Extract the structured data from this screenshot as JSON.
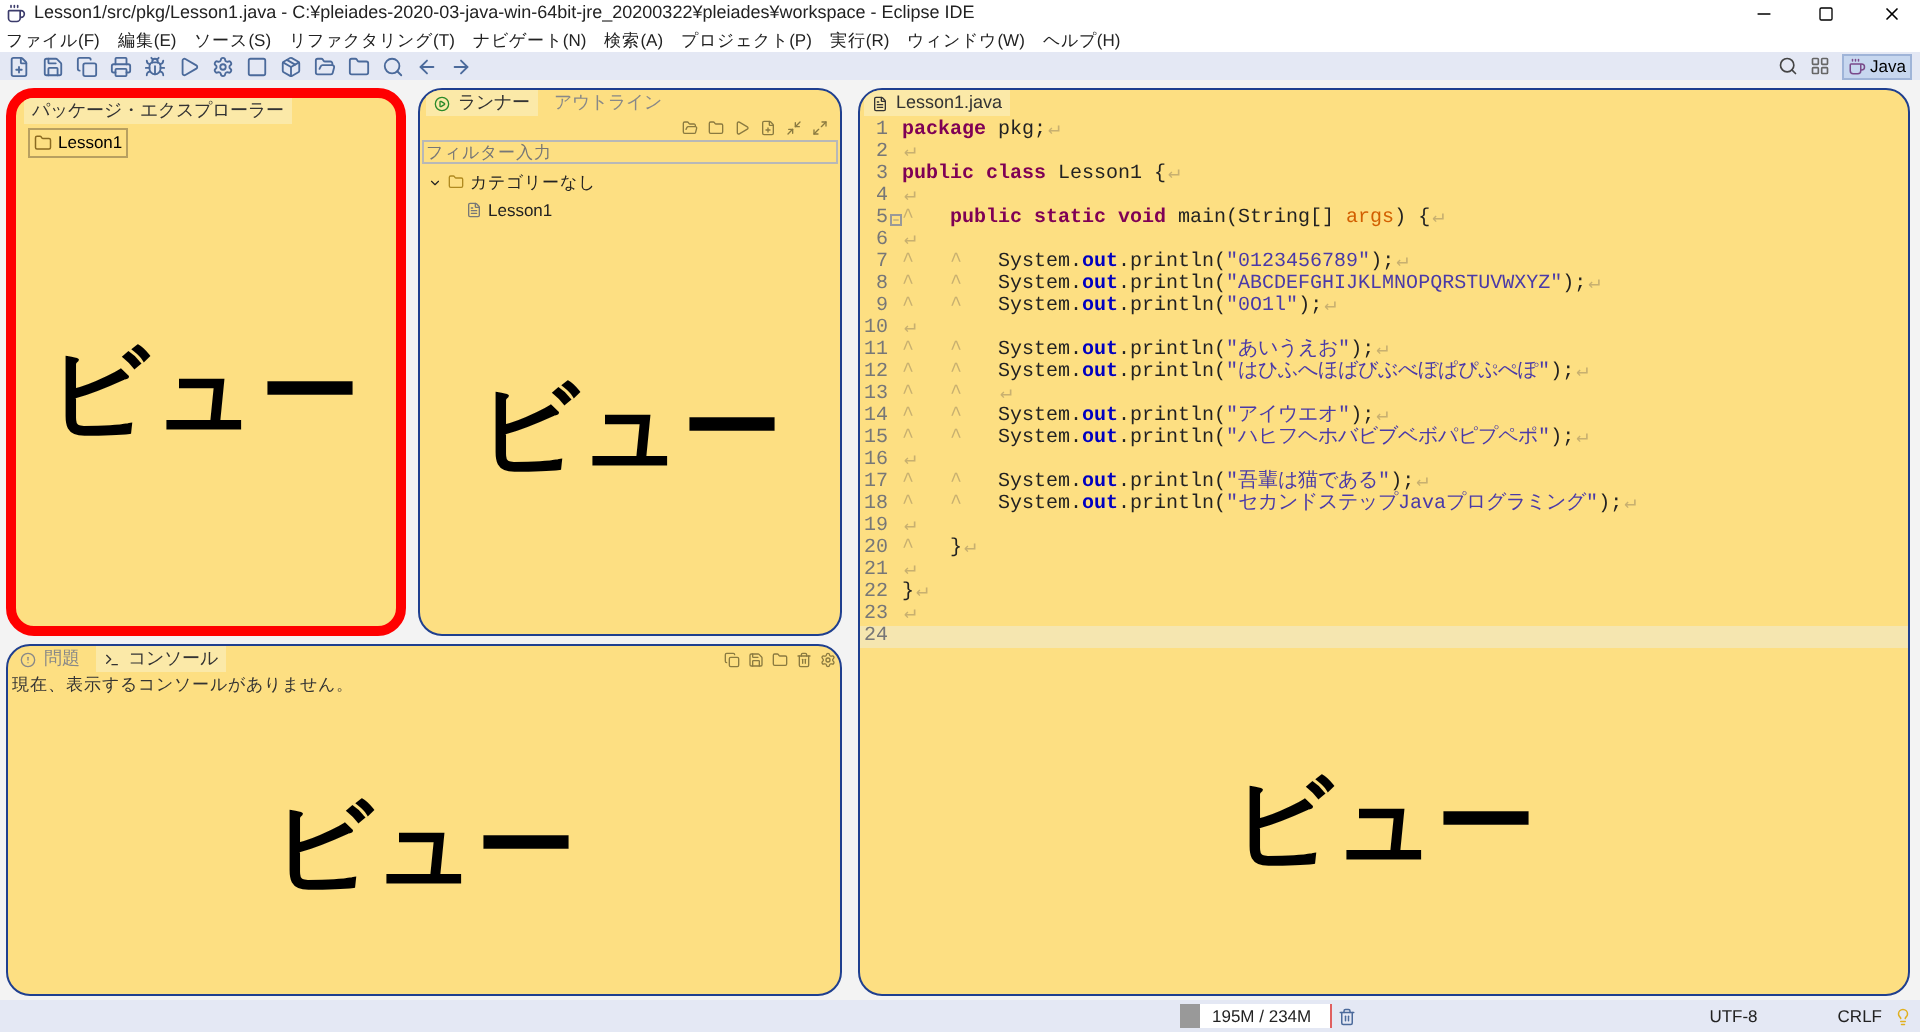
{
  "window": {
    "title": "Lesson1/src/pkg/Lesson1.java - C:¥pleiades-2020-03-java-win-64bit-jre_20200322¥pleiades¥workspace - Eclipse IDE"
  },
  "menu": [
    "ファイル(F)",
    "編集(E)",
    "ソース(S)",
    "リファクタリング(T)",
    "ナビゲート(N)",
    "検索(A)",
    "プロジェクト(P)",
    "実行(R)",
    "ウィンドウ(W)",
    "ヘルプ(H)"
  ],
  "perspective": {
    "label": "Java",
    "selected": true
  },
  "package_explorer": {
    "tabs": [
      {
        "label": "パッケージ・エクスプローラー",
        "selected": true
      }
    ],
    "items": [
      {
        "label": "Lesson1",
        "selected": true
      }
    ],
    "callout": {
      "label": "ビュー",
      "emphasis": true
    }
  },
  "junit": {
    "tabs": [
      {
        "label": "ランナー",
        "selected": true
      },
      {
        "label": "アウトライン",
        "selected": false
      }
    ],
    "filter": {
      "placeholder": "フィルター入力"
    },
    "tree": [
      {
        "label": "カテゴリーなし",
        "expanded": true,
        "children": [
          {
            "label": "Lesson1"
          }
        ]
      }
    ],
    "callout": {
      "label": "ビュー",
      "emphasis": false
    }
  },
  "console": {
    "tabs": [
      {
        "label": "問題",
        "selected": false
      },
      {
        "label": "コンソール",
        "selected": true
      }
    ],
    "message": "現在、表示するコンソールがありません。",
    "callout": {
      "label": "ビュー",
      "emphasis": false
    }
  },
  "editor": {
    "tabs": [
      {
        "label": "Lesson1.java",
        "selected": true
      }
    ],
    "callout": {
      "label": "ビュー",
      "emphasis": false
    },
    "lines": [
      {
        "n": "1",
        "code": [
          {
            "kind": "keyword",
            "t": "package"
          },
          {
            "kind": "plain",
            "t": " pkg;"
          }
        ],
        "eol": "↵",
        "fold": false,
        "current": false
      },
      {
        "n": "2",
        "eol": "↵",
        "fold": false,
        "current": false
      },
      {
        "n": "3",
        "code": [
          {
            "kind": "keyword",
            "t": "public class"
          },
          {
            "kind": "plain",
            "t": " Lesson1 {"
          }
        ],
        "eol": "↵",
        "fold": false,
        "current": false
      },
      {
        "n": "4",
        "eol": "↵",
        "fold": false,
        "current": false
      },
      {
        "n": "5",
        "tabs": [
          "^"
        ],
        "code": [
          {
            "kind": "keyword",
            "t": "public static void"
          },
          {
            "kind": "plain",
            "t": " main(String[] "
          },
          {
            "kind": "param",
            "t": "args"
          },
          {
            "kind": "plain",
            "t": ") {"
          }
        ],
        "eol": "↵",
        "fold": true,
        "current": false
      },
      {
        "n": "6",
        "eol": "↵",
        "fold": false,
        "current": false
      },
      {
        "n": "7",
        "tabs": [
          "^",
          "^"
        ],
        "code": [
          {
            "kind": "plain",
            "t": "System."
          },
          {
            "kind": "field",
            "t": "out"
          },
          {
            "kind": "plain",
            "t": ".println("
          },
          {
            "kind": "string",
            "t": "\"0123456789\""
          },
          {
            "kind": "plain",
            "t": ");"
          }
        ],
        "eol": "↵",
        "fold": false,
        "current": false
      },
      {
        "n": "8",
        "tabs": [
          "^",
          "^"
        ],
        "code": [
          {
            "kind": "plain",
            "t": "System."
          },
          {
            "kind": "field",
            "t": "out"
          },
          {
            "kind": "plain",
            "t": ".println("
          },
          {
            "kind": "string",
            "t": "\"ABCDEFGHIJKLMNOPQRSTUVWXYZ\""
          },
          {
            "kind": "plain",
            "t": ");"
          }
        ],
        "eol": "↵",
        "fold": false,
        "current": false
      },
      {
        "n": "9",
        "tabs": [
          "^",
          "^"
        ],
        "code": [
          {
            "kind": "plain",
            "t": "System."
          },
          {
            "kind": "field",
            "t": "out"
          },
          {
            "kind": "plain",
            "t": ".println("
          },
          {
            "kind": "string",
            "t": "\"0O1l\""
          },
          {
            "kind": "plain",
            "t": ");"
          }
        ],
        "eol": "↵",
        "fold": false,
        "current": false
      },
      {
        "n": "10",
        "eol": "↵",
        "fold": false,
        "current": false
      },
      {
        "n": "11",
        "tabs": [
          "^",
          "^"
        ],
        "code": [
          {
            "kind": "plain",
            "t": "System."
          },
          {
            "kind": "field",
            "t": "out"
          },
          {
            "kind": "plain",
            "t": ".println("
          },
          {
            "kind": "string",
            "t": "\"あいうえお\""
          },
          {
            "kind": "plain",
            "t": ");"
          }
        ],
        "eol": "↵",
        "fold": false,
        "current": false
      },
      {
        "n": "12",
        "tabs": [
          "^",
          "^"
        ],
        "code": [
          {
            "kind": "plain",
            "t": "System."
          },
          {
            "kind": "field",
            "t": "out"
          },
          {
            "kind": "plain",
            "t": ".println("
          },
          {
            "kind": "string",
            "t": "\"はひふへほばびぶべぼぱぴぷぺぽ\""
          },
          {
            "kind": "plain",
            "t": ");"
          }
        ],
        "eol": "↵",
        "fold": false,
        "current": false
      },
      {
        "n": "13",
        "tabs": [
          "^",
          "^"
        ],
        "eol": "↵",
        "fold": false,
        "current": false
      },
      {
        "n": "14",
        "tabs": [
          "^",
          "^"
        ],
        "code": [
          {
            "kind": "plain",
            "t": "System."
          },
          {
            "kind": "field",
            "t": "out"
          },
          {
            "kind": "plain",
            "t": ".println("
          },
          {
            "kind": "string",
            "t": "\"アイウエオ\""
          },
          {
            "kind": "plain",
            "t": ");"
          }
        ],
        "eol": "↵",
        "fold": false,
        "current": false
      },
      {
        "n": "15",
        "tabs": [
          "^",
          "^"
        ],
        "code": [
          {
            "kind": "plain",
            "t": "System."
          },
          {
            "kind": "field",
            "t": "out"
          },
          {
            "kind": "plain",
            "t": ".println("
          },
          {
            "kind": "string",
            "t": "\"ハヒフヘホバビブベボパピプペポ\""
          },
          {
            "kind": "plain",
            "t": ");"
          }
        ],
        "eol": "↵",
        "fold": false,
        "current": false
      },
      {
        "n": "16",
        "eol": "↵",
        "fold": false,
        "current": false
      },
      {
        "n": "17",
        "tabs": [
          "^",
          "^"
        ],
        "code": [
          {
            "kind": "plain",
            "t": "System."
          },
          {
            "kind": "field",
            "t": "out"
          },
          {
            "kind": "plain",
            "t": ".println("
          },
          {
            "kind": "string",
            "t": "\"吾輩は猫である\""
          },
          {
            "kind": "plain",
            "t": ");"
          }
        ],
        "eol": "↵",
        "fold": false,
        "current": false
      },
      {
        "n": "18",
        "tabs": [
          "^",
          "^"
        ],
        "code": [
          {
            "kind": "plain",
            "t": "System."
          },
          {
            "kind": "field",
            "t": "out"
          },
          {
            "kind": "plain",
            "t": ".println("
          },
          {
            "kind": "string",
            "t": "\"セカンドステップJavaプログラミング\""
          },
          {
            "kind": "plain",
            "t": ");"
          }
        ],
        "eol": "↵",
        "fold": false,
        "current": false
      },
      {
        "n": "19",
        "eol": "↵",
        "fold": false,
        "current": false
      },
      {
        "n": "20",
        "tabs": [
          "^"
        ],
        "code": [
          {
            "kind": "plain",
            "t": "}"
          }
        ],
        "eol": "↵",
        "fold": false,
        "current": false
      },
      {
        "n": "21",
        "eol": "↵",
        "fold": false,
        "current": false
      },
      {
        "n": "22",
        "code": [
          {
            "kind": "plain",
            "t": "}"
          }
        ],
        "eol": "↵",
        "fold": false,
        "current": false
      },
      {
        "n": "23",
        "eol": "↵",
        "fold": false,
        "current": false
      },
      {
        "n": "24",
        "fold": false,
        "current": true
      }
    ]
  },
  "status_bar": {
    "heap": {
      "text": "195M / 234M",
      "level": 0.13
    },
    "encoding": "UTF-8",
    "line_delimiter": "CRLF"
  }
}
